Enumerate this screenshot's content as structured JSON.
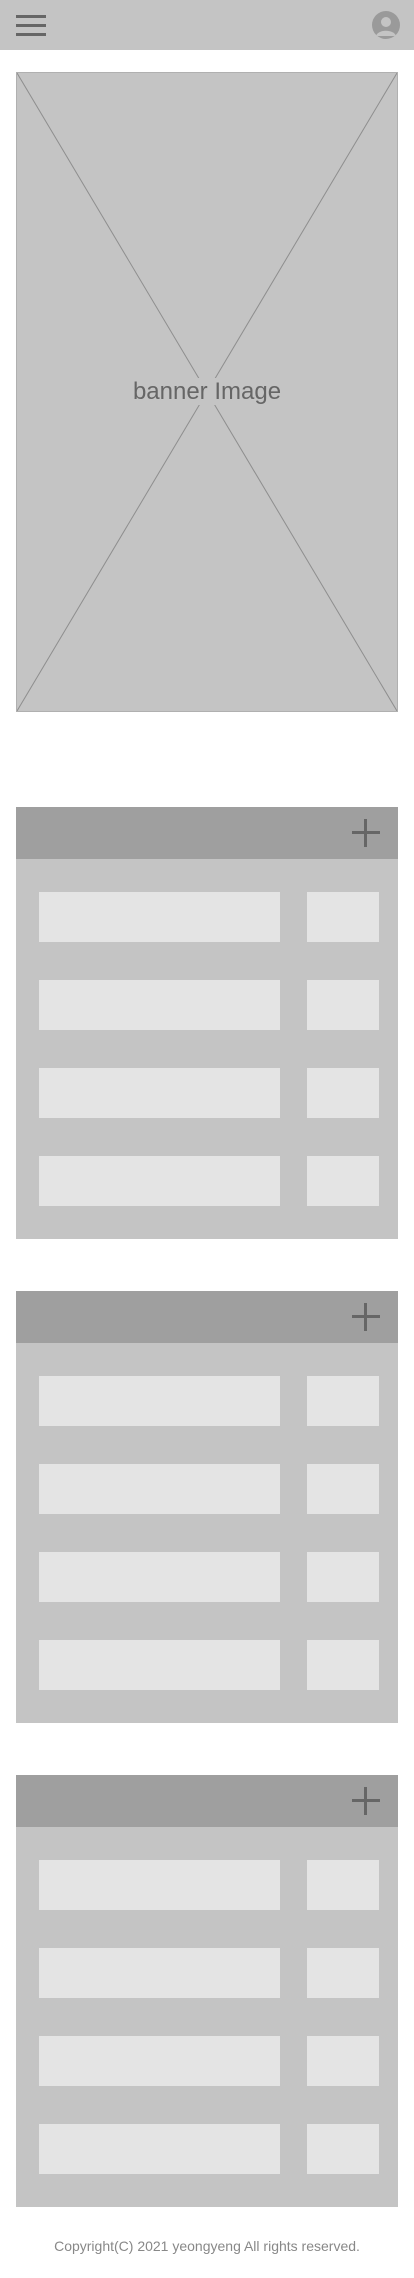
{
  "header": {
    "menu_icon": "hamburger-menu-icon",
    "profile_icon": "user-profile-icon"
  },
  "banner": {
    "label": "banner Image"
  },
  "panels": [
    {
      "add_icon": "plus-icon"
    },
    {
      "add_icon": "plus-icon"
    },
    {
      "add_icon": "plus-icon"
    }
  ],
  "footer": {
    "copyright": "Copyright(C) 2021 yeongyeng All rights reserved."
  },
  "colors": {
    "placeholder": "#c4c4c4",
    "panel_header": "#9f9f9f",
    "row": "#e4e4e4",
    "icon": "#666666"
  }
}
